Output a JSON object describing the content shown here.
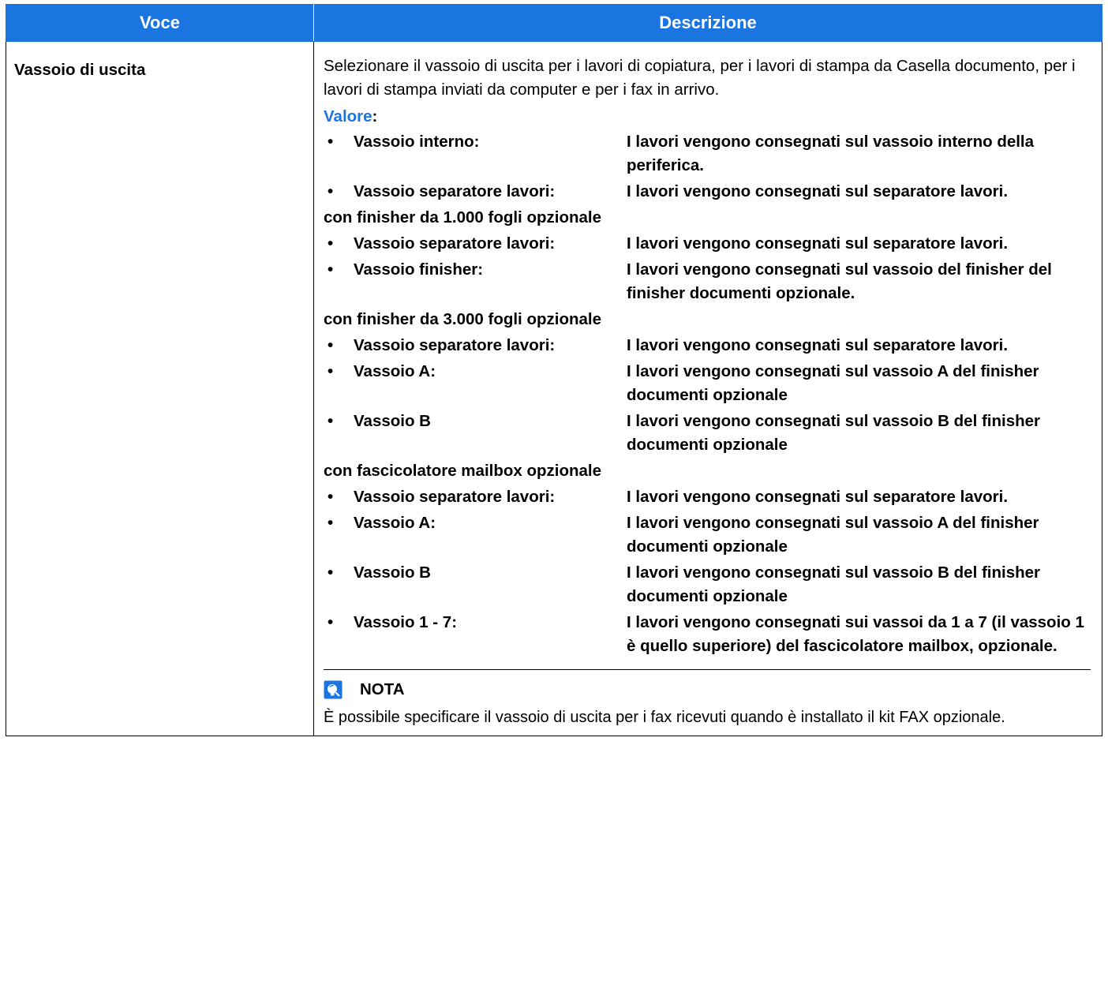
{
  "table": {
    "headers": {
      "voce": "Voce",
      "descrizione": "Descrizione"
    },
    "row": {
      "voce": "Vassoio di uscita",
      "intro": "Selezionare il vassoio di uscita per i lavori di copiatura, per i lavori di stampa da Casella documento, per i lavori di stampa inviati da computer e per i fax in arrivo.",
      "valore_label": "Valore",
      "valore_colon": ":",
      "bullet": "•",
      "base_options": [
        {
          "label": "Vassoio interno:",
          "desc": "I lavori vengono consegnati sul vassoio interno della periferica."
        },
        {
          "label": "Vassoio separatore lavori:",
          "desc": "I lavori vengono consegnati sul separatore lavori."
        }
      ],
      "groups": [
        {
          "heading": "con finisher da 1.000 fogli opzionale",
          "options": [
            {
              "label": "Vassoio separatore lavori:",
              "desc": "I lavori vengono consegnati sul separatore lavori."
            },
            {
              "label": "Vassoio finisher:",
              "desc": "I lavori vengono consegnati sul vassoio del finisher del finisher documenti opzionale."
            }
          ]
        },
        {
          "heading": "con finisher da 3.000 fogli opzionale",
          "options": [
            {
              "label": "Vassoio separatore lavori:",
              "desc": "I lavori vengono consegnati sul separatore lavori."
            },
            {
              "label": "Vassoio A:",
              "desc": "I lavori vengono consegnati sul vassoio A del finisher documenti opzionale"
            },
            {
              "label": "Vassoio B",
              "desc": "I lavori vengono consegnati sul vassoio B del finisher documenti opzionale"
            }
          ]
        },
        {
          "heading": "con fascicolatore mailbox opzionale",
          "options": [
            {
              "label": "Vassoio separatore lavori:",
              "desc": "I lavori vengono consegnati sul separatore lavori."
            },
            {
              "label": "Vassoio A:",
              "desc": "I lavori vengono consegnati sul vassoio A del finisher documenti opzionale"
            },
            {
              "label": "Vassoio B",
              "desc": "I lavori vengono consegnati sul vassoio B del finisher documenti opzionale"
            },
            {
              "label": "Vassoio 1 - 7:",
              "desc": "I lavori vengono consegnati sui vassoi da 1 a 7 (il vassoio 1 è quello superiore) del fascicolatore mailbox, opzionale."
            }
          ]
        }
      ],
      "note": {
        "icon": "note-icon",
        "title": "NOTA",
        "text": "È possibile specificare il vassoio di uscita per i fax ricevuti quando è installato il kit FAX opzionale."
      }
    }
  },
  "colors": {
    "header_bg": "#1a75e0",
    "accent": "#1a75e0",
    "text": "#000000"
  }
}
